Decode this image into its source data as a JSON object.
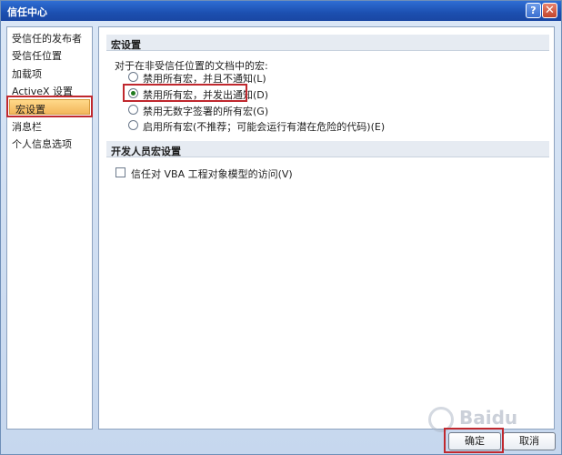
{
  "window": {
    "title": "信任中心",
    "help_label": "?",
    "close_label": "✕"
  },
  "sidebar": {
    "items": [
      {
        "label": "受信任的发布者"
      },
      {
        "label": "受信任位置"
      },
      {
        "label": "加载项"
      },
      {
        "label": "ActiveX 设置"
      },
      {
        "label": "宏设置"
      },
      {
        "label": "消息栏"
      },
      {
        "label": "个人信息选项"
      }
    ],
    "selected_index": 4
  },
  "macro_section": {
    "header": "宏设置",
    "description": "对于在非受信任位置的文档中的宏:",
    "options": [
      {
        "label": "禁用所有宏，并且不通知(L)",
        "selected": false
      },
      {
        "label": "禁用所有宏，并发出通知(D)",
        "selected": true
      },
      {
        "label": "禁用无数字签署的所有宏(G)",
        "selected": false
      },
      {
        "label": "启用所有宏(不推荐；可能会运行有潜在危险的代码)(E)",
        "selected": false
      }
    ]
  },
  "developer_section": {
    "header": "开发人员宏设置",
    "checkbox_label": "信任对 VBA 工程对象模型的访问(V)",
    "checked": false
  },
  "buttons": {
    "ok_label": "确定",
    "cancel_label": "取消"
  },
  "watermark": {
    "text": "Baidu"
  },
  "colors": {
    "title_bar": "#1c4fb0",
    "selection": "#f3b65b",
    "highlight_box": "#c0282e"
  }
}
